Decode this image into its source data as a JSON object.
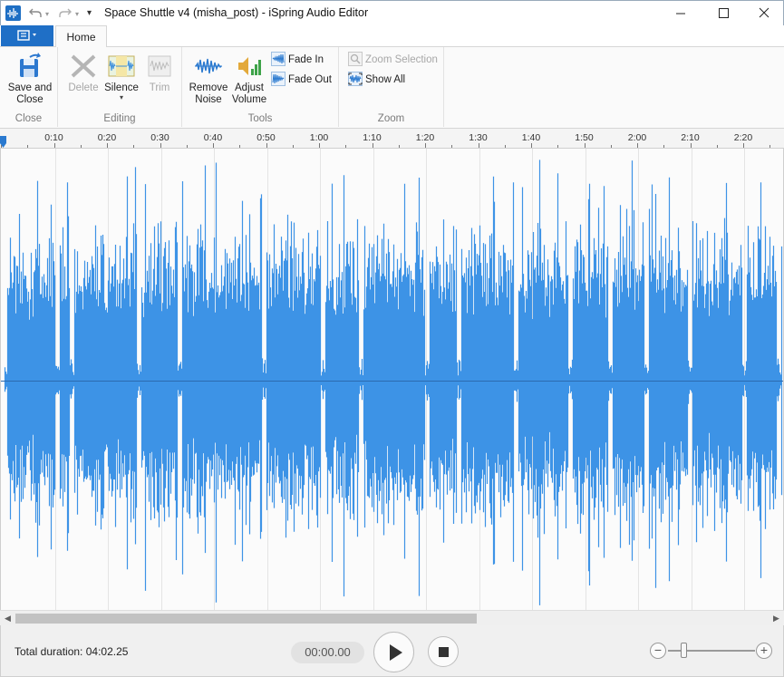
{
  "window": {
    "title": "Space Shuttle v4 (misha_post) - iSpring Audio Editor",
    "minimize_icon": "minimize-icon",
    "maximize_icon": "maximize-icon",
    "close_icon": "close-icon"
  },
  "quick_access": {
    "undo_icon": "undo-icon",
    "redo_icon": "redo-icon",
    "customize_icon": "chevron-down-icon"
  },
  "tabs": {
    "file_icon": "menu-icon",
    "home_label": "Home"
  },
  "ribbon": {
    "groups": {
      "close": "Close",
      "editing": "Editing",
      "tools": "Tools",
      "zoom": "Zoom"
    },
    "save_and_close_line1": "Save and",
    "save_and_close_line2": "Close",
    "delete": "Delete",
    "silence": "Silence",
    "trim": "Trim",
    "remove_noise_line1": "Remove",
    "remove_noise_line2": "Noise",
    "adjust_volume_line1": "Adjust",
    "adjust_volume_line2": "Volume",
    "fade_in": "Fade In",
    "fade_out": "Fade Out",
    "zoom_selection": "Zoom Selection",
    "show_all": "Show All"
  },
  "timeline": {
    "ticks": [
      "0:10",
      "0:20",
      "0:30",
      "0:40",
      "0:50",
      "1:00",
      "1:10",
      "1:20",
      "1:30",
      "1:40",
      "1:50",
      "2:00",
      "2:10",
      "2:20"
    ]
  },
  "colors": {
    "waveform": "#3d93e6",
    "accent": "#1f6fc6"
  },
  "playback": {
    "total_duration": "Total duration: 04:02.25",
    "current_time": "00:00.00",
    "zoom_minus": "−",
    "zoom_plus": "+"
  }
}
